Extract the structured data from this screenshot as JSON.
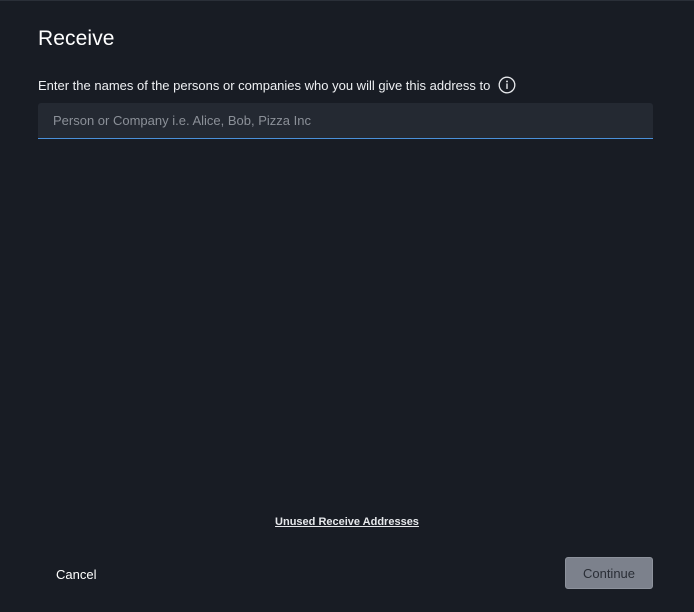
{
  "dialog": {
    "title": "Receive",
    "prompt": "Enter the names of the persons or companies who you will give this address to",
    "info_icon": "info-circle-icon",
    "input": {
      "value": "",
      "placeholder": "Person or Company i.e. Alice, Bob, Pizza Inc"
    },
    "unused_link_label": "Unused Receive Addresses",
    "cancel_label": "Cancel",
    "continue_label": "Continue",
    "continue_enabled": false
  },
  "colors": {
    "background": "#181c24",
    "input_background": "#242932",
    "input_focus_underline": "#4a90d9",
    "continue_disabled": "#7c818c"
  }
}
